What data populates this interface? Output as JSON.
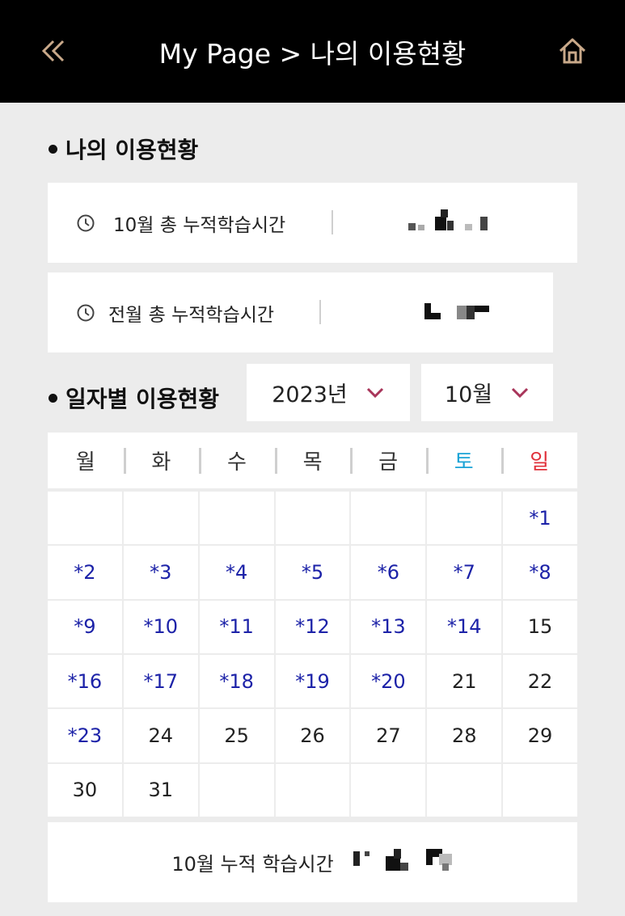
{
  "header": {
    "title": "My Page > 나의 이용현황",
    "back_icon": "double-chevron-left-icon",
    "home_icon": "home-icon"
  },
  "usage": {
    "section_title": "나의 이용현황",
    "current_month_label": "10월 총 누적학습시간",
    "previous_month_label": "전월 총 누적학습시간"
  },
  "daily": {
    "section_title": "일자별 이용현황",
    "year_select": "2023년",
    "month_select": "10월"
  },
  "calendar": {
    "weekdays": [
      "월",
      "화",
      "수",
      "목",
      "금",
      "토",
      "일"
    ],
    "weekday_colors": [
      "#333333",
      "#333333",
      "#333333",
      "#333333",
      "#333333",
      "#1ba3d6",
      "#e0303a"
    ],
    "studied_color": "#1c22a8",
    "cells": [
      "",
      "",
      "",
      "",
      "",
      "",
      "*1",
      "*2",
      "*3",
      "*4",
      "*5",
      "*6",
      "*7",
      "*8",
      "*9",
      "*10",
      "*11",
      "*12",
      "*13",
      "*14",
      "15",
      "*16",
      "*17",
      "*18",
      "*19",
      "*20",
      "21",
      "22",
      "*23",
      "24",
      "25",
      "26",
      "27",
      "28",
      "29",
      "30",
      "31",
      "",
      "",
      "",
      "",
      ""
    ]
  },
  "monthly_total": {
    "label": "10월 누적 학습시간"
  },
  "colors": {
    "accent_chevron": "#a8355a",
    "header_bg": "#000000",
    "icon_tan": "#c9a98a"
  }
}
